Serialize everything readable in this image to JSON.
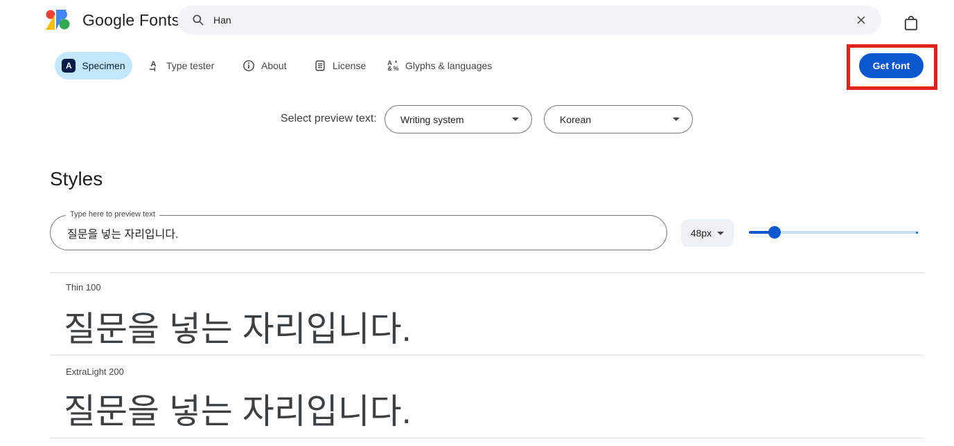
{
  "header": {
    "logo_text": "Google Fonts",
    "search": {
      "value": "Han"
    }
  },
  "tabs": [
    {
      "label": "Specimen",
      "selected": true
    },
    {
      "label": "Type tester",
      "selected": false
    },
    {
      "label": "About",
      "selected": false
    },
    {
      "label": "License",
      "selected": false
    },
    {
      "label": "Glyphs & languages",
      "selected": false
    }
  ],
  "get_font_label": "Get font",
  "preview_select": {
    "label": "Select preview text:",
    "writing_system_value": "Writing system",
    "language_value": "Korean"
  },
  "styles_section": {
    "title": "Styles",
    "input_label": "Type here to preview text",
    "input_value": "질문을 넣는 자리입니다.",
    "size_value": "48px",
    "slider_percent": 15,
    "styles": [
      {
        "name": "Thin 100",
        "sample": "질문을 넣는 자리입니다."
      },
      {
        "name": "ExtraLight 200",
        "sample": "질문을 넣는 자리입니다."
      }
    ]
  },
  "icons": {
    "specimen_letter": "A",
    "glyphs_chars": [
      "A",
      "*",
      "&",
      "%"
    ]
  },
  "colors": {
    "accent_blue": "#0b57d0",
    "selected_tab_bg": "#c2e7ff",
    "annotation_red": "#e2231a",
    "search_bg": "#f1f4f9",
    "slider_track": "#c5e0f8"
  }
}
